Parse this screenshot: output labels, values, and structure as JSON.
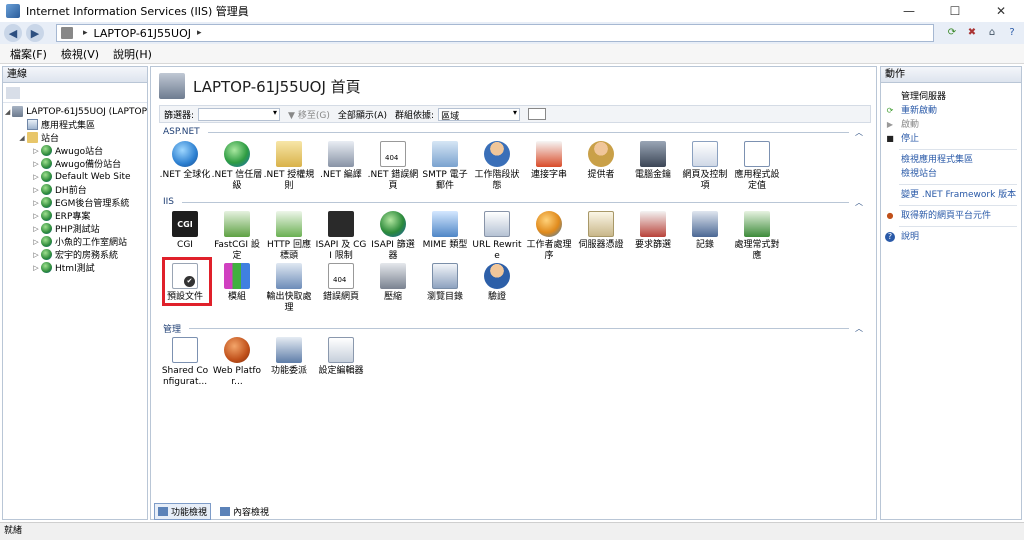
{
  "window": {
    "title": "Internet Information Services (IIS) 管理員",
    "controls": [
      "—",
      "☐",
      "✕"
    ]
  },
  "address": {
    "path": "LAPTOP-61J55UOJ",
    "sep": "▸"
  },
  "menu": [
    "檔案(F)",
    "檢視(V)",
    "說明(H)"
  ],
  "left": {
    "header": "連線",
    "tree": [
      {
        "label": "LAPTOP-61J55UOJ (LAPTOP",
        "icon": "server-icon",
        "exp": "◢"
      },
      {
        "label": "應用程式集區",
        "icon": "app-pool-icon",
        "exp": ""
      },
      {
        "label": "站台",
        "icon": "sites-folder-icon",
        "exp": "◢"
      },
      {
        "label": "Awugo站台",
        "icon": "globe-icon",
        "exp": "▷"
      },
      {
        "label": "Awugo備份站台",
        "icon": "globe-icon",
        "exp": "▷"
      },
      {
        "label": "Default Web Site",
        "icon": "globe-icon",
        "exp": "▷"
      },
      {
        "label": "DH前台",
        "icon": "globe-icon",
        "exp": "▷"
      },
      {
        "label": "EGM後台管理系統",
        "icon": "globe-icon",
        "exp": "▷"
      },
      {
        "label": "ERP專案",
        "icon": "globe-icon",
        "exp": "▷"
      },
      {
        "label": "PHP測試站",
        "icon": "globe-icon",
        "exp": "▷"
      },
      {
        "label": "小魚的工作室網站",
        "icon": "globe-icon",
        "exp": "▷"
      },
      {
        "label": "宏宇的房務系統",
        "icon": "globe-icon",
        "exp": "▷"
      },
      {
        "label": "Html測試",
        "icon": "globe-icon",
        "exp": "▷"
      }
    ]
  },
  "center": {
    "title": "LAPTOP-61J55UOJ 首頁",
    "filter": {
      "label": "篩選器:",
      "go": "▼ 移至(G)",
      "show_all": "全部顯示(A)",
      "group_label": "群組依據:",
      "group_value": "區域"
    },
    "sections": {
      "aspnet": "ASP.NET",
      "iis": "IIS",
      "manage": "管理"
    },
    "aspnet_items": [
      ".NET 全球化",
      ".NET 信任層級",
      ".NET 授權規則",
      ".NET 編譯",
      ".NET 錯誤網頁",
      "SMTP 電子郵件",
      "工作階段狀態",
      "連接字串",
      "提供者",
      "電腦金鑰",
      "網頁及控制項",
      "應用程式設定值"
    ],
    "iis_items_row1": [
      "CGI",
      "FastCGI 設定",
      "HTTP 回應標頭",
      "ISAPI 及 CGI 限制",
      "ISAPI 篩選器",
      "MIME 類型",
      "URL Rewrite",
      "工作者處理序",
      "伺服器憑證",
      "要求篩選",
      "記錄",
      "處理常式對應"
    ],
    "iis_items_row2": [
      "預設文件",
      "模組",
      "輸出快取處理",
      "錯誤網頁",
      "壓縮",
      "瀏覽目錄",
      "驗證"
    ],
    "manage_items": [
      "Shared Configurat...",
      "Web Platfor...",
      "功能委派",
      "設定編輯器"
    ],
    "tabs": [
      "功能檢視",
      "內容檢視"
    ]
  },
  "right": {
    "header": "動作",
    "manage_server": "管理伺服器",
    "restart": "重新啟動",
    "start": "啟動",
    "stop": "停止",
    "view_pools": "檢視應用程式集區",
    "view_sites": "檢視站台",
    "change_framework": "變更 .NET Framework 版本",
    "get_components": "取得新的網頁平台元件",
    "help": "說明"
  },
  "status": "就緒"
}
